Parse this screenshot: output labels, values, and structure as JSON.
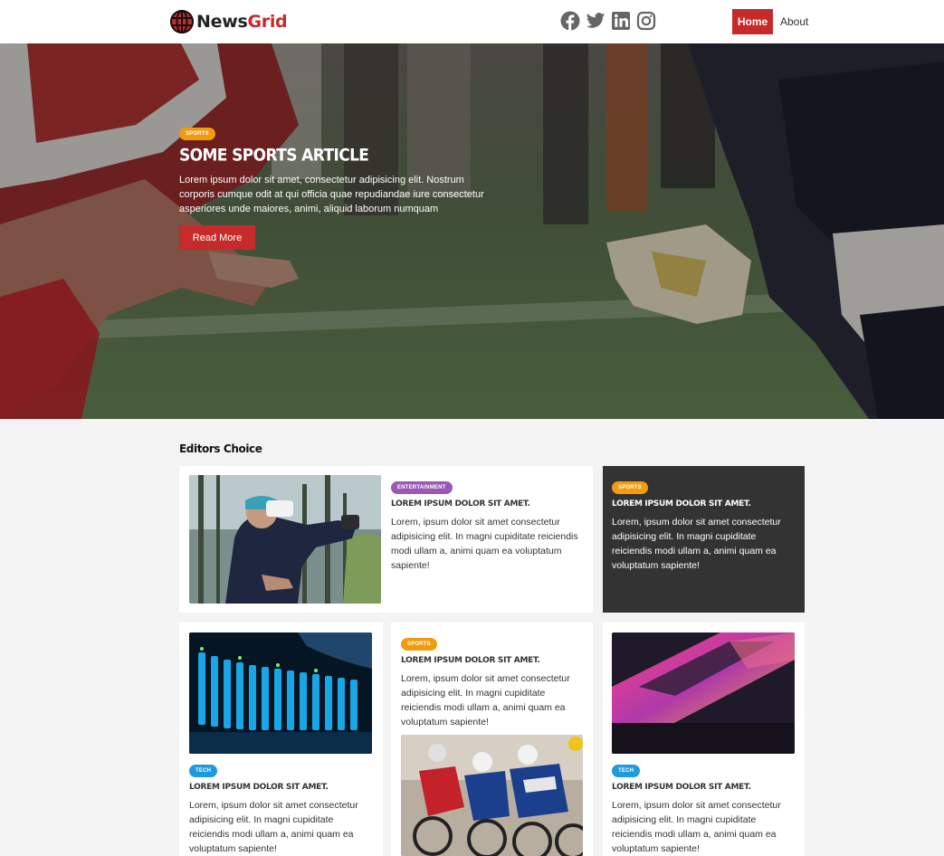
{
  "nav": {
    "brand_part1": "News",
    "brand_part2": "Grid",
    "home": "Home",
    "about": "About",
    "social_icons": [
      "facebook-icon",
      "twitter-icon",
      "linkedin-icon",
      "instagram-icon"
    ]
  },
  "hero": {
    "category": "Sports",
    "title": "Some Sports Article",
    "text": "Lorem ipsum dolor sit amet, consectetur adipisicing elit. Nostrum corporis cumque odit at qui officia quae repudiandae iure consectetur asperiores unde maiores, animi, aliquid laborum numquam",
    "button": "Read More"
  },
  "editors": {
    "title": "Editors Choice",
    "articles": [
      {
        "category": "Entertainment",
        "title": "Lorem ipsum dolor sit amet.",
        "text": "Lorem, ipsum dolor sit amet consectetur adipisicing elit. In magni cupiditate reiciendis modi ullam a, animi quam ea voluptatum sapiente!"
      },
      {
        "category": "Sports",
        "title": "Lorem ipsum dolor sit amet.",
        "text": "Lorem, ipsum dolor sit amet consectetur adipisicing elit. In magni cupiditate reiciendis modi ullam a, animi quam ea voluptatum sapiente!"
      },
      {
        "category": "Tech",
        "title": "Lorem ipsum dolor sit amet.",
        "text": "Lorem, ipsum dolor sit amet consectetur adipisicing elit. In magni cupiditate reiciendis modi ullam a, animi quam ea voluptatum sapiente!"
      },
      {
        "category": "Sports",
        "title": "Lorem ipsum dolor sit amet.",
        "text": "Lorem, ipsum dolor sit amet consectetur adipisicing elit. In magni cupiditate reiciendis modi ullam a, animi quam ea voluptatum sapiente!"
      },
      {
        "category": "Tech",
        "title": "Lorem ipsum dolor sit amet.",
        "text": "Lorem, ipsum dolor sit amet consectetur adipisicing elit. In magni cupiditate reiciendis modi ullam a, animi quam ea voluptatum sapiente!"
      }
    ]
  },
  "colors": {
    "accent": "#c72a2a",
    "sports": "#f29b0c",
    "entertainment": "#9b59b6",
    "tech": "#1e9bdc",
    "dark_card": "#333333"
  }
}
